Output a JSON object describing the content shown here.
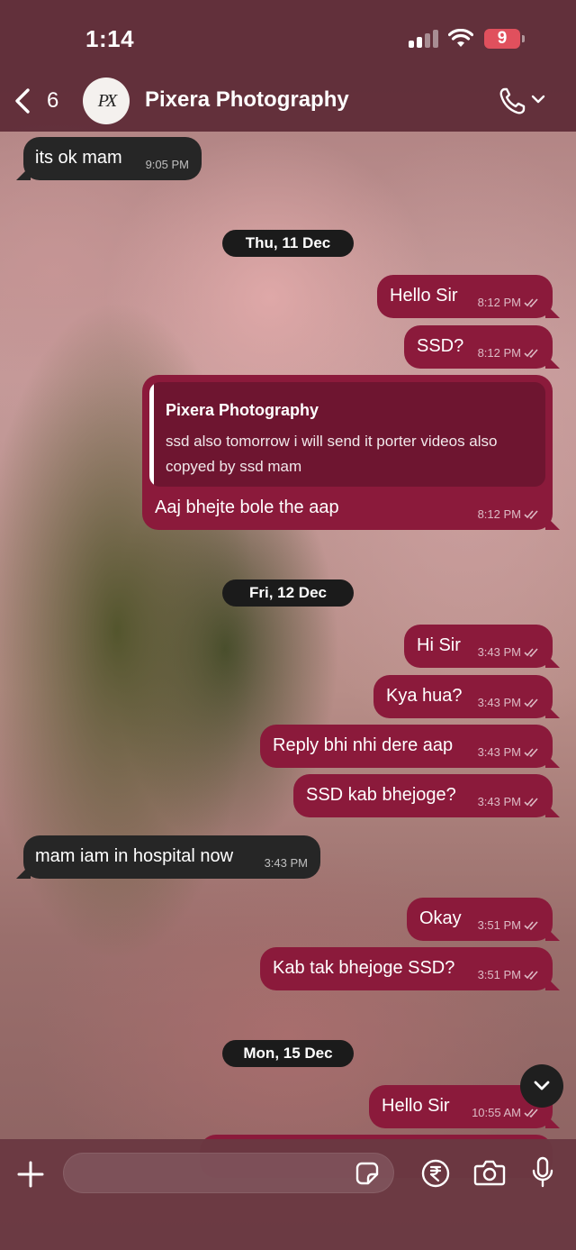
{
  "status_bar": {
    "time": "1:14",
    "battery": "9"
  },
  "header": {
    "back_count": "6",
    "avatar_text": "PX",
    "contact_name": "Pixera Photography"
  },
  "messages": [
    {
      "dir": "in",
      "text": "its ok mam",
      "time": "9:05 PM"
    },
    {
      "date": "Thu, 11 Dec"
    },
    {
      "dir": "out",
      "text": "Hello Sir",
      "time": "8:12 PM"
    },
    {
      "dir": "out",
      "text": "SSD?",
      "time": "8:12 PM"
    },
    {
      "dir": "out",
      "text": "Aaj bhejte bole the aap",
      "time": "8:12 PM",
      "quote": {
        "author": "Pixera Photography",
        "line1": "ssd also tomorrow i will send it porter videos also",
        "line2": "copyed by ssd mam"
      }
    },
    {
      "date": "Fri, 12 Dec"
    },
    {
      "dir": "out",
      "text": "Hi Sir",
      "time": "3:43 PM"
    },
    {
      "dir": "out",
      "text": "Kya hua?",
      "time": "3:43 PM"
    },
    {
      "dir": "out",
      "text": "Reply bhi nhi dere aap",
      "time": "3:43 PM"
    },
    {
      "dir": "out",
      "text": "SSD kab bhejoge?",
      "time": "3:43 PM"
    },
    {
      "dir": "in",
      "text": "mam iam in hospital now",
      "time": "3:43 PM"
    },
    {
      "dir": "out",
      "text": "Okay",
      "time": "3:51 PM"
    },
    {
      "dir": "out",
      "text": "Kab tak bhejoge SSD?",
      "time": "3:51 PM"
    },
    {
      "date": "Mon, 15 Dec"
    },
    {
      "dir": "out",
      "text": "Hello Sir",
      "time": "10:55 AM"
    }
  ],
  "icons": {
    "back": "chevron-left-icon",
    "call": "phone-icon",
    "scroll": "chevron-down-icon",
    "attach": "plus-icon",
    "sticker": "sticker-icon",
    "payment": "rupee-icon",
    "camera": "camera-icon",
    "mic": "microphone-icon",
    "read": "double-check-icon"
  },
  "colors": {
    "outgoing": "#8b1a3b",
    "incoming": "#262626",
    "date_chip": "#1b1b1b",
    "battery": "#e0505d"
  }
}
